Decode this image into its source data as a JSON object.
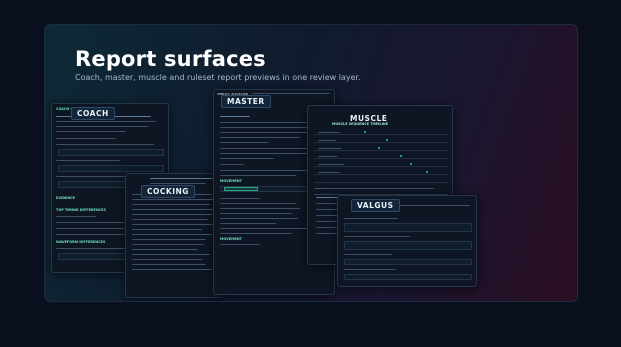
{
  "hero": {
    "title": "Report surfaces",
    "subtitle": "Coach, master, muscle and ruleset report previews in one review layer."
  },
  "cards": {
    "coach": {
      "title": "COACH",
      "header": "COACH SUMMARY",
      "sections": [
        "EVIDENCE",
        "TOP TIMING DIFFERENCES",
        "WAVEFORM DIFFERENCES"
      ]
    },
    "cocking": {
      "title": "COCKING"
    },
    "master": {
      "title": "MASTER",
      "header": "VERDICT ELEVATION",
      "sections": [
        "MOVEMENT",
        "MOVEMENT"
      ]
    },
    "muscle": {
      "title": "MUSCLE",
      "header": "MUSCLE SEQUENCE TIMELINE"
    },
    "valgus": {
      "title": "VALGUS"
    }
  },
  "colors": {
    "accent": "#2fd0a8",
    "heading": "#ffffff",
    "card_bg": "#0d1622"
  }
}
